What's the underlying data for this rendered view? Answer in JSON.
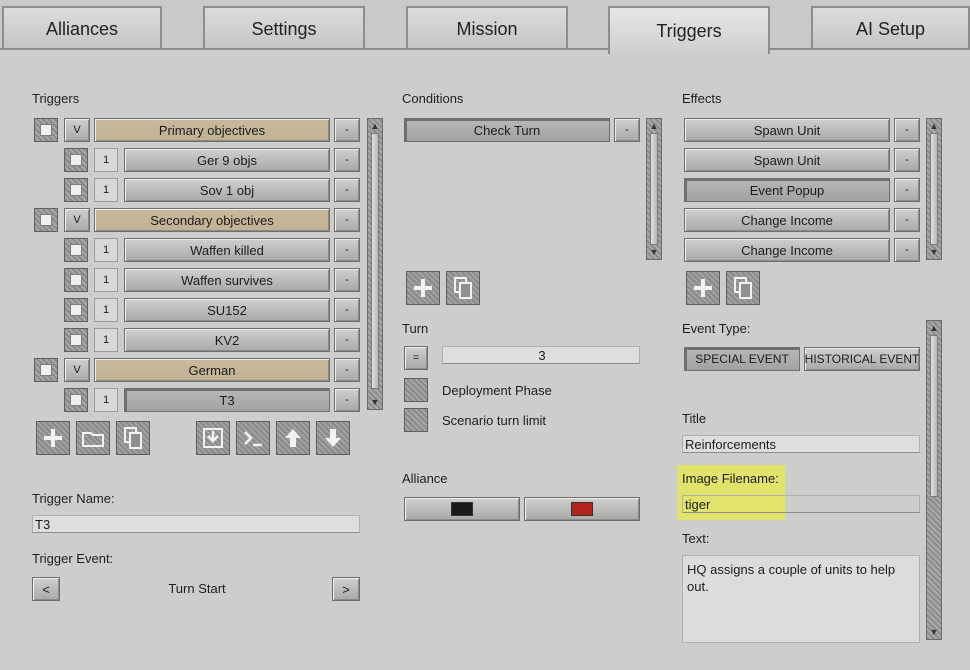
{
  "tabs": [
    {
      "label": "Alliances",
      "active": false
    },
    {
      "label": "Settings",
      "active": false
    },
    {
      "label": "Mission",
      "active": false
    },
    {
      "label": "Triggers",
      "active": true
    },
    {
      "label": "AI Setup",
      "active": false
    }
  ],
  "triggers": {
    "header": "Triggers",
    "rows": [
      {
        "kind": "group",
        "prefix": "V",
        "label": "Primary objectives",
        "remove": "-"
      },
      {
        "kind": "item",
        "prefix": "1",
        "label": "Ger 9 objs",
        "remove": "-"
      },
      {
        "kind": "item",
        "prefix": "1",
        "label": "Sov 1 obj",
        "remove": "-"
      },
      {
        "kind": "group",
        "prefix": "V",
        "label": "Secondary objectives",
        "remove": "-"
      },
      {
        "kind": "item",
        "prefix": "1",
        "label": "Waffen killed",
        "remove": "-"
      },
      {
        "kind": "item",
        "prefix": "1",
        "label": "Waffen survives",
        "remove": "-"
      },
      {
        "kind": "item",
        "prefix": "1",
        "label": "SU152",
        "remove": "-"
      },
      {
        "kind": "item",
        "prefix": "1",
        "label": "KV2",
        "remove": "-"
      },
      {
        "kind": "group",
        "prefix": "V",
        "label": "German",
        "remove": "-"
      },
      {
        "kind": "item",
        "prefix": "1",
        "label": "T3",
        "remove": "-",
        "selected": true
      }
    ],
    "tool_icons": [
      "add-icon",
      "folder-icon",
      "copy-icon",
      "import-icon",
      "console-icon",
      "move-up-icon",
      "move-down-icon"
    ],
    "name_label": "Trigger Name:",
    "name_value": "T3",
    "event_label": "Trigger Event:",
    "event_value": "Turn Start",
    "prev": "<",
    "next": ">"
  },
  "conditions": {
    "header": "Conditions",
    "items": [
      {
        "label": "Check Turn",
        "remove": "-"
      }
    ],
    "tool_icons": [
      "add-icon",
      "copy-icon"
    ],
    "turn_label": "Turn",
    "turn_op": "=",
    "turn_value": "3",
    "checks": [
      "Deployment Phase",
      "Scenario turn limit"
    ],
    "alliance_label": "Alliance",
    "alliance_colors": [
      "#1a1a1a",
      "#b3241c"
    ]
  },
  "effects": {
    "header": "Effects",
    "items": [
      {
        "label": "Spawn Unit",
        "remove": "-"
      },
      {
        "label": "Spawn Unit",
        "remove": "-"
      },
      {
        "label": "Event Popup",
        "remove": "-",
        "selected": true
      },
      {
        "label": "Change Income",
        "remove": "-"
      },
      {
        "label": "Change Income",
        "remove": "-"
      }
    ],
    "tool_icons": [
      "add-icon",
      "copy-icon"
    ],
    "event_type_label": "Event Type:",
    "event_types": [
      {
        "label": "SPECIAL EVENT",
        "selected": true
      },
      {
        "label": "HISTORICAL EVENT",
        "selected": false
      }
    ],
    "title_label": "Title",
    "title_value": "Reinforcements",
    "image_label": "Image Filename:",
    "image_value": "tiger",
    "text_label": "Text:",
    "text_value": "HQ assigns a couple of units to help out."
  },
  "colors": {
    "group_row": "#c2b295",
    "highlight": "#f3f51f"
  }
}
